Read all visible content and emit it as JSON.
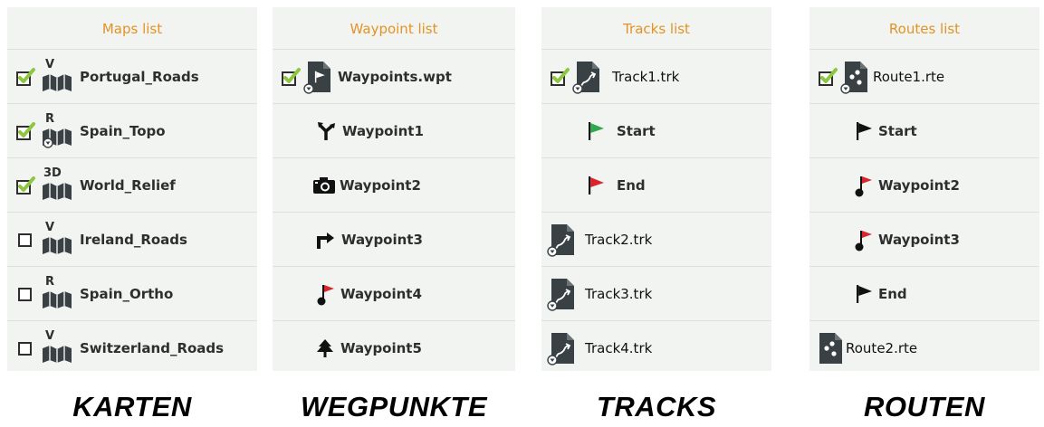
{
  "panels": {
    "maps": {
      "header": "Maps list",
      "items": [
        {
          "label": "Portugal_Roads",
          "badge": "V",
          "checked": true
        },
        {
          "label": "Spain_Topo",
          "badge": "R",
          "checked": true
        },
        {
          "label": "World_Relief",
          "badge": "3D",
          "checked": true
        },
        {
          "label": "Ireland_Roads",
          "badge": "V",
          "checked": false
        },
        {
          "label": "Spain_Ortho",
          "badge": "R",
          "checked": false
        },
        {
          "label": "Switzerland_Roads",
          "badge": "V",
          "checked": false
        }
      ],
      "caption": "KARTEN"
    },
    "waypoints": {
      "header": "Waypoint list",
      "items": [
        {
          "label": "Waypoints.wpt",
          "icon": "waypoint-file-icon",
          "checked": true
        },
        {
          "label": "Waypoint1",
          "icon": "junction-icon"
        },
        {
          "label": "Waypoint2",
          "icon": "camera-icon"
        },
        {
          "label": "Waypoint3",
          "icon": "turn-right-icon"
        },
        {
          "label": "Waypoint4",
          "icon": "pin-flag-icon"
        },
        {
          "label": "Waypoint5",
          "icon": "tree-icon"
        }
      ],
      "caption": "WEGPUNKTE"
    },
    "tracks": {
      "header": "Tracks list",
      "items": [
        {
          "label": "Track1.trk",
          "icon": "track-file-icon",
          "checked": true
        },
        {
          "label": "Start",
          "icon": "green-flag-icon"
        },
        {
          "label": "End",
          "icon": "red-flag-icon"
        },
        {
          "label": "Track2.trk",
          "icon": "track-file-icon"
        },
        {
          "label": "Track3.trk",
          "icon": "track-file-icon"
        },
        {
          "label": "Track4.trk",
          "icon": "track-file-icon"
        }
      ],
      "caption": "TRACKS"
    },
    "routes": {
      "header": "Routes list",
      "items": [
        {
          "label": "Route1.rte",
          "icon": "route-file-icon",
          "checked": true
        },
        {
          "label": "Start",
          "icon": "black-flag-icon"
        },
        {
          "label": "Waypoint2",
          "icon": "pin-flag-icon"
        },
        {
          "label": "Waypoint3",
          "icon": "pin-flag-icon"
        },
        {
          "label": "End",
          "icon": "black-flag-icon"
        },
        {
          "label": "Route2.rte",
          "icon": "route-file-icon"
        }
      ],
      "caption": "ROUTEN"
    }
  },
  "colors": {
    "header_text": "#e39325",
    "panel_bg": "#f2f4f1",
    "check_green": "#8dc63f",
    "icon_dark": "#3a4144",
    "flag_green": "#2fa84f",
    "flag_red": "#d9262c"
  }
}
